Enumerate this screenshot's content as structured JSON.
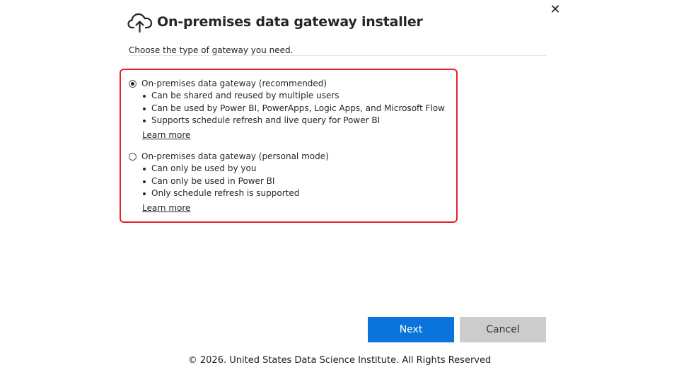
{
  "window": {
    "title": "On-premises data gateway installer",
    "close_label": "✕",
    "cloud_icon": "cloud-upload-icon"
  },
  "main": {
    "subtitle": "Choose the type of gateway you need.",
    "highlight_color": "#e8202a",
    "options": [
      {
        "label": "On-premises data gateway (recommended)",
        "selected": true,
        "bullets": [
          "Can be shared and reused by multiple users",
          "Can be used by Power BI, PowerApps, Logic Apps, and Microsoft Flow",
          "Supports schedule refresh and live query for Power BI"
        ],
        "link": "Learn more"
      },
      {
        "label": "On-premises data gateway (personal mode)",
        "selected": false,
        "bullets": [
          "Can only be used by you",
          "Can only be used in Power BI",
          "Only schedule refresh is supported"
        ],
        "link": "Learn more"
      }
    ]
  },
  "buttons": {
    "next_label": "Next",
    "cancel_label": "Cancel",
    "next_color": "#0a74da",
    "cancel_color": "#cccccc"
  },
  "footer": {
    "copyright": "© 2026. United States Data Science Institute. All Rights Reserved"
  }
}
